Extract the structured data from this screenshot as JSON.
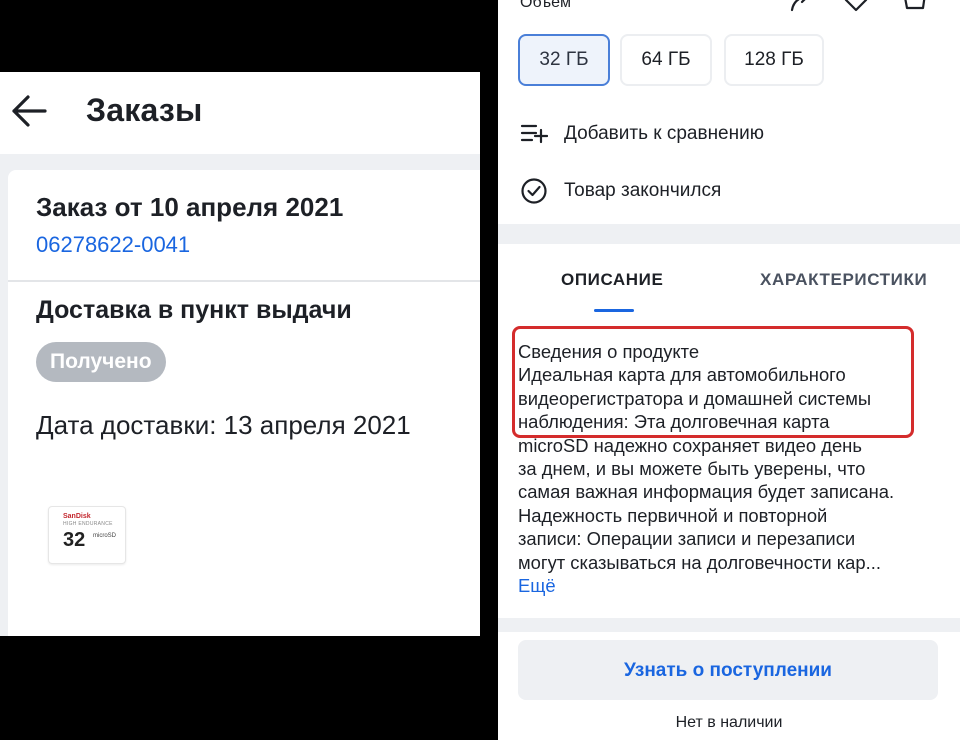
{
  "orders_screen": {
    "title": "Заказы",
    "order": {
      "title": "Заказ от 10 апреля 2021",
      "number": "06278622-0041",
      "delivery_type": "Доставка в пункт выдачи",
      "status": "Получено",
      "delivery_date": "Дата доставки: 13 апреля 2021"
    },
    "product_thumb": {
      "brand": "SanDisk",
      "line": "HIGH ENDURANCE",
      "capacity": "32",
      "marks": "microSD"
    }
  },
  "product_screen": {
    "volume_label": "Объем",
    "sizes": [
      {
        "label": "32 ГБ",
        "selected": true
      },
      {
        "label": "64 ГБ",
        "selected": false
      },
      {
        "label": "128 ГБ",
        "selected": false
      }
    ],
    "actions": [
      {
        "label": "Добавить к сравнению",
        "icon": "compare-list-icon"
      },
      {
        "label": "Товар закончился",
        "icon": "check-circle-icon"
      }
    ],
    "tabs": [
      {
        "label": "ОПИСАНИЕ",
        "active": true
      },
      {
        "label": "ХАРАКТЕРИСТИКИ",
        "active": false
      }
    ],
    "description_lines": [
      "Сведения о продукте",
      "Идеальная карта для автомобильного",
      "видеорегистратора и домашней системы",
      "наблюдения: Эта долговечная карта",
      "microSD надежно сохраняет видео день",
      "за днем, и вы можете быть уверены, что",
      "самая важная информация будет записана.",
      "Надежность первичной и повторной",
      "записи: Операции записи и перезаписи",
      "могут сказываться на долговечности кар..."
    ],
    "more_link": "Ещё",
    "notify_button": "Узнать о поступлении",
    "stock_note": "Нет в наличии",
    "colors": {
      "accent": "#1a66e0",
      "highlight": "#d42c2c",
      "badge": "#b4b9c0"
    }
  }
}
